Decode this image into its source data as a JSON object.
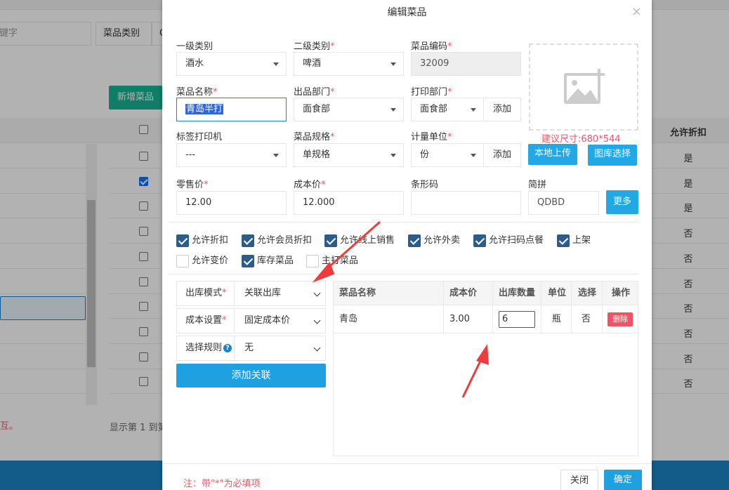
{
  "background": {
    "search_placeholder": "键字",
    "category_label": "菜品类别",
    "category_cut": "Q",
    "new_button": "新增菜品",
    "column_header": "允许折扣",
    "row_values": [
      "是",
      "是",
      "是",
      "否",
      "否",
      "否",
      "否",
      "否",
      "否",
      "否"
    ],
    "footer_text": "显示第 1 到第",
    "red_text": "互。"
  },
  "modal": {
    "title": "编辑菜品",
    "close_symbol": "×",
    "fields": {
      "level1": {
        "label": "一级类别",
        "value": "酒水"
      },
      "level2": {
        "label": "二级类别",
        "value": "啤酒"
      },
      "code": {
        "label": "菜品编码",
        "value": "32009"
      },
      "name": {
        "label": "菜品名称",
        "value": "青岛半打"
      },
      "out_dept": {
        "label": "出品部门",
        "value": "面食部"
      },
      "print_dept": {
        "label": "打印部门",
        "value": "面食部",
        "add": "添加"
      },
      "label_printer": {
        "label": "标签打印机",
        "value": "---"
      },
      "spec": {
        "label": "菜品规格",
        "value": "单规格"
      },
      "unit": {
        "label": "计量单位",
        "value": "份",
        "add": "添加"
      },
      "retail_price": {
        "label": "零售价",
        "value": "12.00"
      },
      "cost_price": {
        "label": "成本价",
        "value": "12.000"
      },
      "barcode": {
        "label": "条形码",
        "value": ""
      },
      "pinyin": {
        "label": "简拼",
        "value": "QDBD",
        "more": "更多"
      }
    },
    "required_mark": "*",
    "image": {
      "hint": "建议尺寸:680*544",
      "upload_local": "本地上传",
      "gallery_select": "图库选择"
    },
    "checkboxes": [
      {
        "label": "允许折扣",
        "checked": true
      },
      {
        "label": "允许会员折扣",
        "checked": true
      },
      {
        "label": "允许线上销售",
        "checked": true
      },
      {
        "label": "允许外卖",
        "checked": true
      },
      {
        "label": "允许扫码点餐",
        "checked": true
      },
      {
        "label": "上架",
        "checked": true
      },
      {
        "label": "允许变价",
        "checked": false
      },
      {
        "label": "库存菜品",
        "checked": true
      },
      {
        "label": "主打菜品",
        "checked": false
      }
    ],
    "stock": {
      "mode_label": "出库模式",
      "mode_value": "关联出库",
      "cost_label": "成本设置",
      "cost_value": "固定成本价",
      "rule_label": "选择规则",
      "rule_help": "?",
      "rule_value": "无",
      "add_relation": "添加关联"
    },
    "relation_table": {
      "headers": [
        "菜品名称",
        "成本价",
        "出库数量",
        "单位",
        "选择",
        "操作"
      ],
      "rows": [
        {
          "name": "青岛",
          "cost": "3.00",
          "qty": "6",
          "unit": "瓶",
          "select": "否",
          "action": "删除"
        }
      ]
    },
    "footer": {
      "note": "注：带\"*\"为必填项",
      "close": "关闭",
      "confirm": "确定"
    }
  },
  "colors": {
    "accent_blue": "#1fa0e0",
    "checkbox_blue": "#2c5d8a",
    "required_red": "#ed5565",
    "annotation_arrow": "#ee3b3b"
  }
}
